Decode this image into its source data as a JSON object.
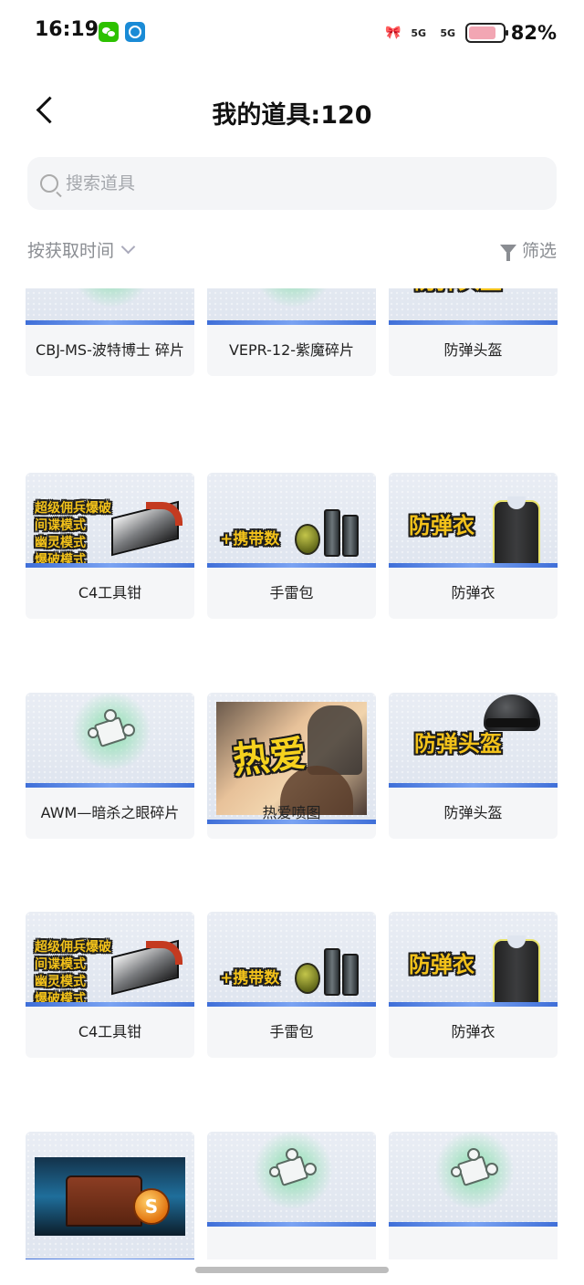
{
  "status_bar": {
    "time": "16:19",
    "signal_1": "5G",
    "signal_2": "5G",
    "battery": "82%",
    "battery_level": 0.82
  },
  "header": {
    "title": "我的道具:120"
  },
  "search": {
    "placeholder": "搜索道具"
  },
  "toolbar": {
    "sort_label": "按获取时间",
    "filter_label": "筛选"
  },
  "items": [
    {
      "label": "CBJ-MS-波特博士 碎片",
      "icon": "puzzle-piece"
    },
    {
      "label": "VEPR-12-紫魔碎片",
      "icon": "puzzle-piece"
    },
    {
      "label": "防弹头盔",
      "icon": "helmet",
      "image_text": "防弹头盔"
    },
    {
      "label": "C4工具钳",
      "icon": "c4-tool",
      "image_text": [
        "超级佣兵爆破",
        "间谍模式",
        "幽灵模式",
        "爆破模式"
      ]
    },
    {
      "label": "手雷包",
      "icon": "grenade-pack",
      "image_text": "+携带数"
    },
    {
      "label": "防弹衣",
      "icon": "vest",
      "image_text": "防弹衣"
    },
    {
      "label": "AWM—暗杀之眼碎片",
      "icon": "puzzle-piece"
    },
    {
      "label": "热爱喷图",
      "icon": "spray",
      "image_text": "热爱"
    },
    {
      "label": "防弹头盔",
      "icon": "helmet",
      "image_text": "防弹头盔"
    },
    {
      "label": "C4工具钳",
      "icon": "c4-tool",
      "image_text": [
        "超级佣兵爆破",
        "间谍模式",
        "幽灵模式",
        "爆破模式"
      ]
    },
    {
      "label": "手雷包",
      "icon": "grenade-pack",
      "image_text": "+携带数"
    },
    {
      "label": "防弹衣",
      "icon": "vest",
      "image_text": "防弹衣"
    },
    {
      "label": "",
      "icon": "treasure-chest"
    },
    {
      "label": "",
      "icon": "puzzle-piece"
    },
    {
      "label": "",
      "icon": "puzzle-piece"
    }
  ]
}
